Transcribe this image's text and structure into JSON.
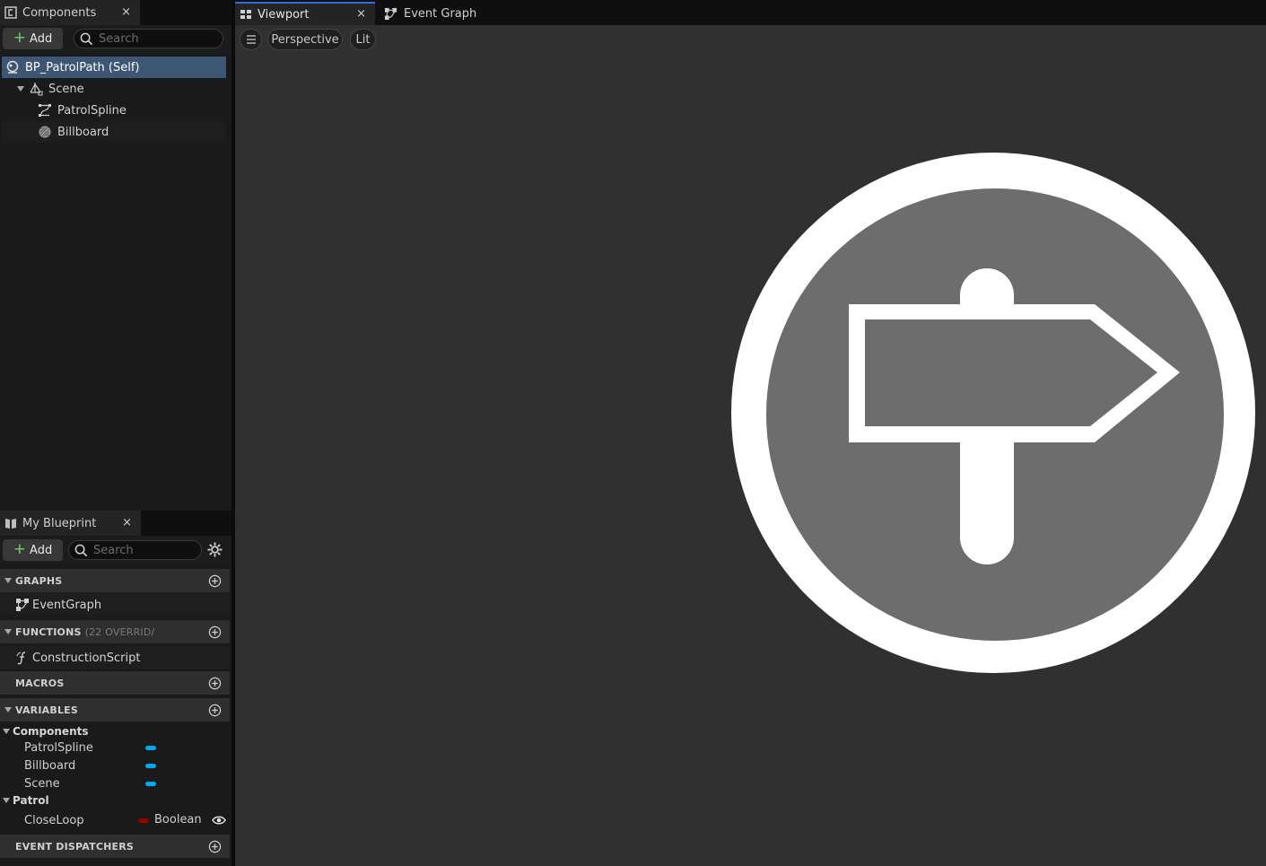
{
  "components_panel": {
    "tab_label": "Components",
    "close_glyph": "×",
    "add_label": "Add",
    "search_placeholder": "Search",
    "items": [
      {
        "label": "BP_PatrolPath (Self)",
        "icon": "actor-icon"
      },
      {
        "label": "Scene",
        "icon": "scene-component-icon"
      },
      {
        "label": "PatrolSpline",
        "icon": "spline-icon"
      },
      {
        "label": "Billboard",
        "icon": "billboard-icon"
      }
    ]
  },
  "my_blueprint": {
    "tab_label": "My Blueprint",
    "close_glyph": "×",
    "add_label": "Add",
    "search_placeholder": "Search",
    "sections": {
      "graphs": {
        "label": "GRAPHS",
        "items": [
          "EventGraph"
        ]
      },
      "functions": {
        "label": "FUNCTIONS",
        "note": "(22 OVERRID/",
        "items": [
          "ConstructionScript"
        ]
      },
      "macros": {
        "label": "MACROS"
      },
      "variables": {
        "label": "VARIABLES"
      },
      "event_dispatchers": {
        "label": "EVENT DISPATCHERS"
      }
    },
    "variable_categories": [
      {
        "name": "Components",
        "vars": [
          {
            "name": "PatrolSpline",
            "color": "#00a8f0"
          },
          {
            "name": "Billboard",
            "color": "#00a8f0"
          },
          {
            "name": "Scene",
            "color": "#00a8f0"
          }
        ]
      },
      {
        "name": "Patrol",
        "vars": [
          {
            "name": "CloseLoop",
            "color": "#940000",
            "type": "Boolean"
          }
        ]
      }
    ]
  },
  "viewport": {
    "tab_label": "Viewport",
    "close_glyph": "×",
    "event_graph_tab": "Event Graph",
    "perspective_label": "Perspective",
    "lit_label": "Lit"
  }
}
